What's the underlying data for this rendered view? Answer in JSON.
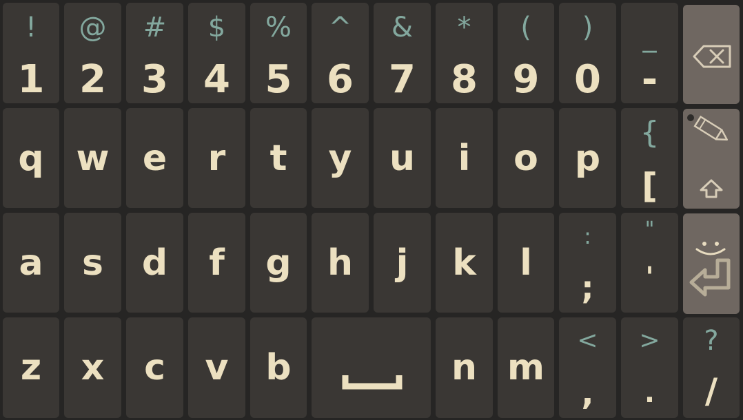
{
  "colors": {
    "background": "#262524",
    "key": "#3a3734",
    "function_key": "#6f6761",
    "primary_text": "#ece0c0",
    "secondary_text": "#83a89e"
  },
  "rows": {
    "numbers": [
      {
        "main": "1",
        "sub": "!"
      },
      {
        "main": "2",
        "sub": "@"
      },
      {
        "main": "3",
        "sub": "#"
      },
      {
        "main": "4",
        "sub": "$"
      },
      {
        "main": "5",
        "sub": "%"
      },
      {
        "main": "6",
        "sub": "^"
      },
      {
        "main": "7",
        "sub": "&"
      },
      {
        "main": "8",
        "sub": "*"
      },
      {
        "main": "9",
        "sub": "("
      },
      {
        "main": "0",
        "sub": ")"
      },
      {
        "main": "-",
        "sub": "_"
      }
    ],
    "top": [
      {
        "main": "q"
      },
      {
        "main": "w"
      },
      {
        "main": "e"
      },
      {
        "main": "r"
      },
      {
        "main": "t"
      },
      {
        "main": "y"
      },
      {
        "main": "u"
      },
      {
        "main": "i"
      },
      {
        "main": "o"
      },
      {
        "main": "p"
      },
      {
        "main": "[",
        "sub": "{"
      }
    ],
    "home": [
      {
        "main": "a"
      },
      {
        "main": "s"
      },
      {
        "main": "d"
      },
      {
        "main": "f"
      },
      {
        "main": "g"
      },
      {
        "main": "h"
      },
      {
        "main": "j"
      },
      {
        "main": "k"
      },
      {
        "main": "l"
      },
      {
        "main": ";",
        "sub": ":"
      },
      {
        "main": "'",
        "sub": "\""
      }
    ],
    "bottom": [
      {
        "main": "z"
      },
      {
        "main": "x"
      },
      {
        "main": "c"
      },
      {
        "main": "v"
      },
      {
        "main": "b"
      },
      {
        "main": "n"
      },
      {
        "main": "m"
      },
      {
        "main": ",",
        "sub": "<"
      },
      {
        "main": ".",
        "sub": ">"
      },
      {
        "main": "/",
        "sub": "?"
      }
    ]
  },
  "function_keys": {
    "backspace_icon": "backspace-icon",
    "edit_icon": "pencil-icon",
    "shift_icon": "shift-arrow-icon",
    "emoji_icon": "smiley-icon",
    "enter_icon": "enter-return-icon",
    "space_icon": "space-bar-icon"
  }
}
